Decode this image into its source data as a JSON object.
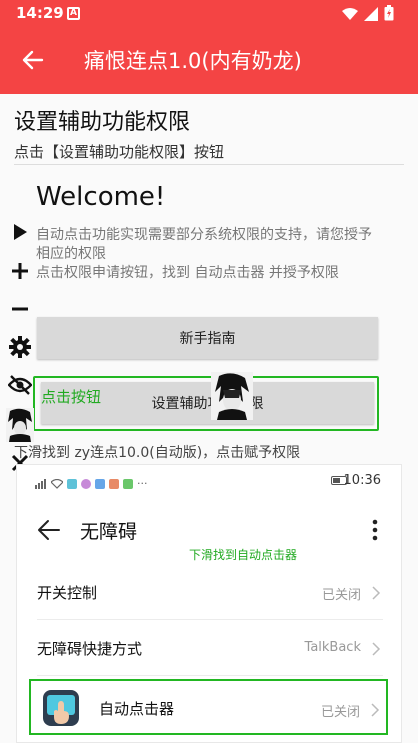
{
  "status_bar": {
    "time": "14:29",
    "badge": "A"
  },
  "app_bar": {
    "title": "痛恨连点1.0(内有奶龙)",
    "color": "#f44444"
  },
  "main": {
    "heading": "设置辅助功能权限",
    "subheading": "点击【设置辅助功能权限】按钮",
    "welcome": "Welcome!",
    "desc_line1": "自动点击功能实现需要部分系统权限的支持，请您授予相应的权限",
    "desc_line2": "点击权限申请按钮，找到 自动点击器 并授予权限",
    "guide_button": "新手指南",
    "settings_button": "设置辅助功能权限",
    "highlight_label": "点击按钮",
    "instruction": "下滑找到 zy连点10.0(自动版)，点击赋予权限"
  },
  "floating_toolbar": {
    "items": [
      "play-icon",
      "plus-icon",
      "minus-icon",
      "gear-icon",
      "eye-off-icon",
      "avatar",
      "close-icon"
    ]
  },
  "embedded_screenshot": {
    "time": "10:36",
    "title": "无障碍",
    "hint": "下滑找到自动点击器",
    "rows": [
      {
        "label": "开关控制",
        "value": "已关闭"
      },
      {
        "label": "无障碍快捷方式",
        "value": "TalkBack"
      },
      {
        "label": "自动点击器",
        "value": "已关闭"
      }
    ]
  },
  "colors": {
    "accent": "#f44444",
    "highlight": "#22b722"
  }
}
